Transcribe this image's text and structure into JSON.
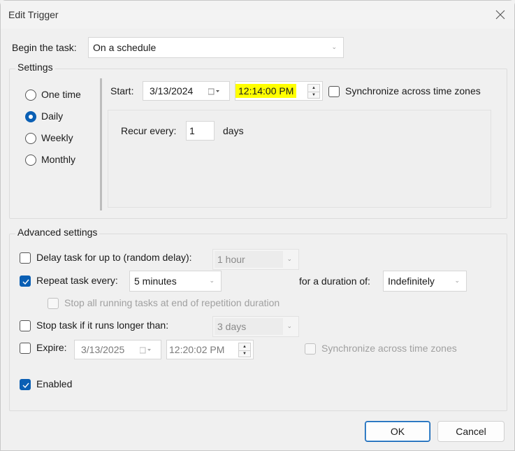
{
  "window": {
    "title": "Edit Trigger",
    "close_icon": "close-icon"
  },
  "begin_task": {
    "label": "Begin the task:",
    "value": "On a schedule"
  },
  "settings": {
    "title": "Settings",
    "frequency": [
      {
        "label": "One time",
        "checked": false
      },
      {
        "label": "Daily",
        "checked": true
      },
      {
        "label": "Weekly",
        "checked": false
      },
      {
        "label": "Monthly",
        "checked": false
      }
    ],
    "start_label": "Start:",
    "start_date": "3/13/2024",
    "start_time": "12:14:00 PM",
    "start_time_highlight": "#ffff00",
    "sync_label": "Synchronize across time zones",
    "sync_checked": false,
    "recur_label": "Recur every:",
    "recur_value": "1",
    "recur_unit": "days"
  },
  "advanced": {
    "title": "Advanced settings",
    "delay": {
      "label": "Delay task for up to (random delay):",
      "checked": false,
      "value": "1 hour"
    },
    "repeat": {
      "label": "Repeat task every:",
      "checked": true,
      "value": "5 minutes",
      "duration_label": "for a duration of:",
      "duration_value": "Indefinitely"
    },
    "stop_all": {
      "label": "Stop all running tasks at end of repetition duration",
      "checked": false
    },
    "stop_longer": {
      "label": "Stop task if it runs longer than:",
      "checked": false,
      "value": "3 days"
    },
    "expire": {
      "label": "Expire:",
      "checked": false,
      "date": "3/13/2025",
      "time": "12:20:02 PM",
      "sync_label": "Synchronize across time zones",
      "sync_checked": false
    },
    "enabled": {
      "label": "Enabled",
      "checked": true
    }
  },
  "buttons": {
    "ok": "OK",
    "cancel": "Cancel"
  },
  "colors": {
    "accent": "#0a5fb4",
    "highlight": "#ffff00"
  }
}
